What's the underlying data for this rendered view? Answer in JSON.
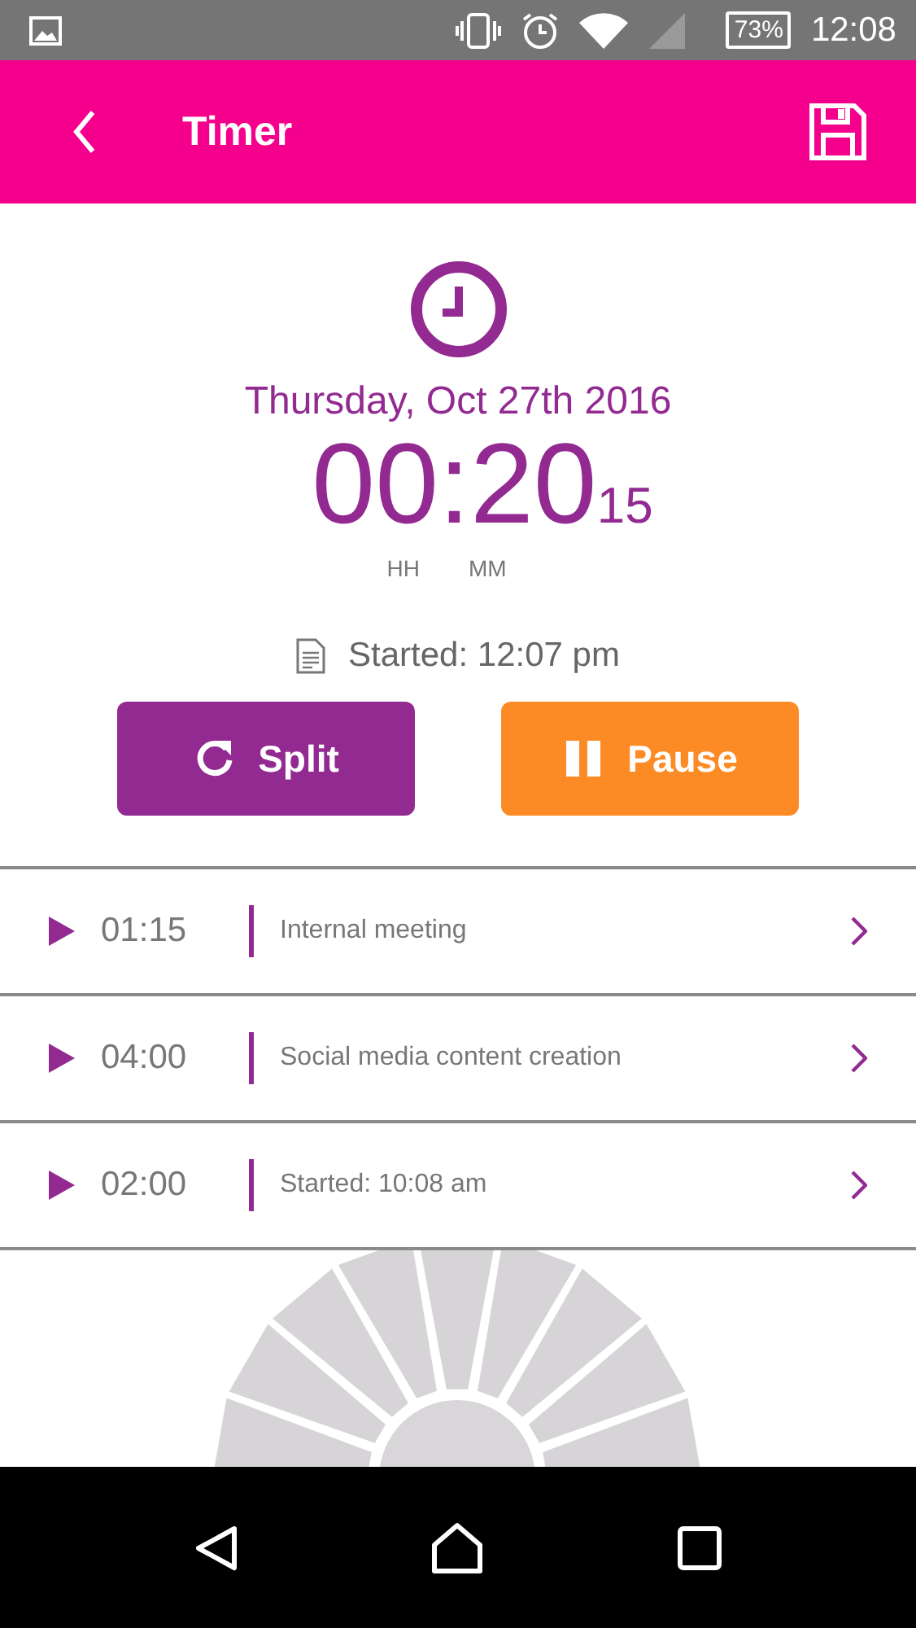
{
  "status_bar": {
    "battery": "73%",
    "time": "12:08"
  },
  "app_bar": {
    "title": "Timer"
  },
  "date": "Thursday, Oct 27th 2016",
  "timer": {
    "hours_minutes": "00:20",
    "seconds": "15",
    "labels": [
      "HH",
      "MM"
    ]
  },
  "started": "Started: 12:07 pm",
  "buttons": [
    {
      "label": "Split",
      "kind": "split"
    },
    {
      "label": "Pause",
      "kind": "pause"
    }
  ],
  "entries": [
    {
      "duration": "01:15",
      "description": "Internal meeting"
    },
    {
      "duration": "04:00",
      "description": "Social media content creation"
    },
    {
      "duration": "02:00",
      "description": "Started: 10:08 am"
    }
  ]
}
